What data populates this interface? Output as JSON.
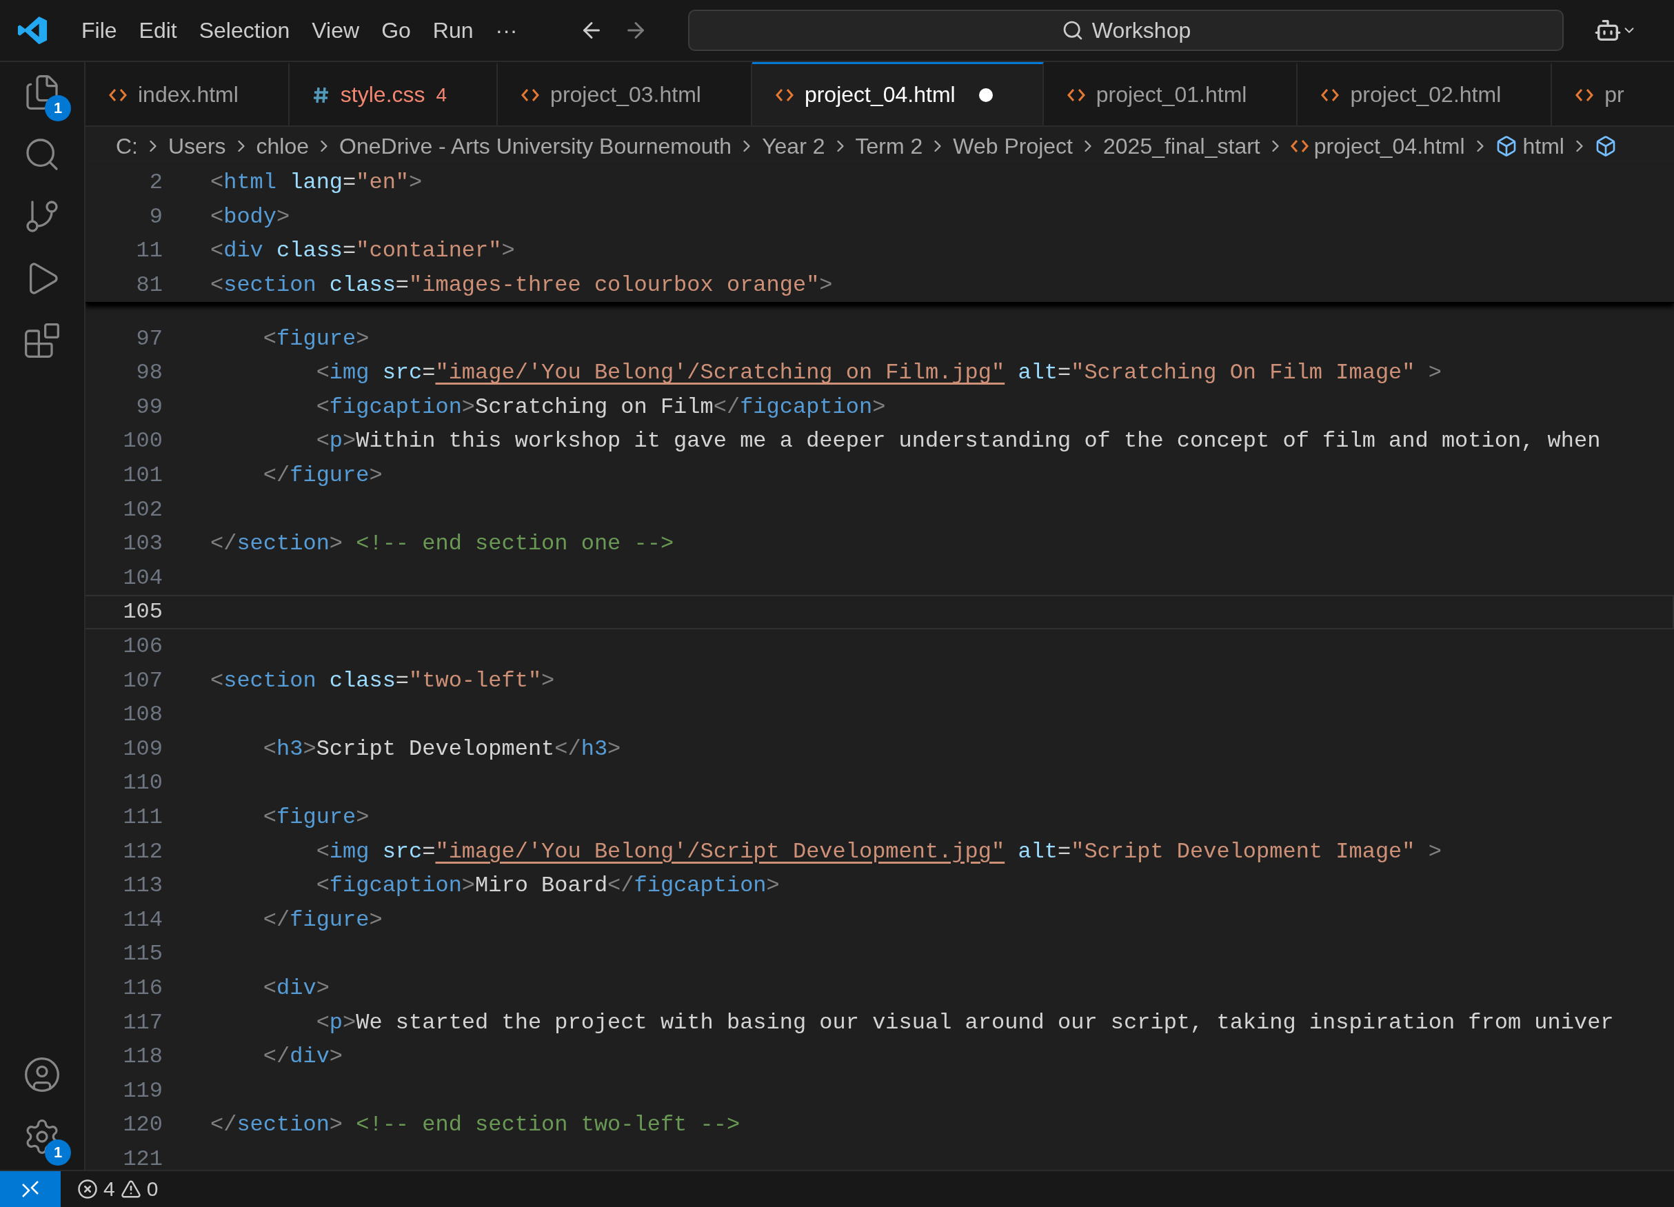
{
  "title_bar": {
    "menu": [
      "File",
      "Edit",
      "Selection",
      "View",
      "Go",
      "Run",
      "···"
    ],
    "search": {
      "value": "Workshop"
    }
  },
  "activity_bar": {
    "top": [
      {
        "kind": "explorer",
        "badge": "1"
      },
      {
        "kind": "search"
      },
      {
        "kind": "source-control"
      },
      {
        "kind": "run"
      },
      {
        "kind": "extensions"
      }
    ],
    "bottom": [
      {
        "kind": "account"
      },
      {
        "kind": "settings",
        "badge": "1"
      }
    ]
  },
  "tabs": [
    {
      "label": "index.html",
      "kind": "html",
      "selected": false,
      "modified": false
    },
    {
      "label": "style.css",
      "kind": "css",
      "selected": false,
      "modified": false,
      "errors": "4"
    },
    {
      "label": "project_03.html",
      "kind": "html",
      "selected": false,
      "modified": false
    },
    {
      "label": "project_04.html",
      "kind": "html",
      "selected": true,
      "modified": true
    },
    {
      "label": "project_01.html",
      "kind": "html",
      "selected": false,
      "modified": false
    },
    {
      "label": "project_02.html",
      "kind": "html",
      "selected": false,
      "modified": false
    },
    {
      "label": "pr",
      "kind": "html",
      "selected": false,
      "modified": false
    }
  ],
  "breadcrumb": [
    {
      "label": "C:",
      "kind": "folder"
    },
    {
      "label": "Users",
      "kind": "folder"
    },
    {
      "label": "chloe",
      "kind": "folder"
    },
    {
      "label": "OneDrive - Arts University Bournemouth",
      "kind": "folder"
    },
    {
      "label": "Year 2",
      "kind": "folder"
    },
    {
      "label": "Term 2",
      "kind": "folder"
    },
    {
      "label": "Web Project",
      "kind": "folder"
    },
    {
      "label": "2025_final_start",
      "kind": "folder"
    },
    {
      "label": "project_04.html",
      "kind": "html"
    },
    {
      "label": "html",
      "kind": "symbol"
    },
    {
      "kind": "symbol"
    }
  ],
  "sticky_lines": [
    {
      "number": "2",
      "code": [
        {
          "kind": "punct",
          "text": "<"
        },
        {
          "kind": "tag",
          "text": "html "
        },
        {
          "kind": "attr",
          "text": "lang"
        },
        {
          "kind": "plain",
          "text": "="
        },
        {
          "kind": "string",
          "text": "\"en\""
        },
        {
          "kind": "punct",
          "text": ">"
        }
      ]
    },
    {
      "number": "9",
      "code": [
        {
          "kind": "punct",
          "text": "<"
        },
        {
          "kind": "tag",
          "text": "body"
        },
        {
          "kind": "punct",
          "text": ">"
        }
      ]
    },
    {
      "number": "11",
      "code": [
        {
          "kind": "punct",
          "text": "<"
        },
        {
          "kind": "tag",
          "text": "div "
        },
        {
          "kind": "attr",
          "text": "class"
        },
        {
          "kind": "plain",
          "text": "="
        },
        {
          "kind": "string",
          "text": "\"container\""
        },
        {
          "kind": "punct",
          "text": ">"
        }
      ]
    },
    {
      "number": "81",
      "code": [
        {
          "kind": "punct",
          "text": "<"
        },
        {
          "kind": "tag",
          "text": "section "
        },
        {
          "kind": "attr",
          "text": "class"
        },
        {
          "kind": "plain",
          "text": "="
        },
        {
          "kind": "string",
          "text": "\"images-three colourbox orange\""
        },
        {
          "kind": "punct",
          "text": ">"
        }
      ]
    }
  ],
  "lines": [
    {
      "number": "97",
      "selected": false,
      "code": [
        {
          "kind": "punct",
          "text": "    <"
        },
        {
          "kind": "tag",
          "text": "figure"
        },
        {
          "kind": "punct",
          "text": ">"
        }
      ]
    },
    {
      "number": "98",
      "selected": false,
      "code": [
        {
          "kind": "punct",
          "text": "        <"
        },
        {
          "kind": "tag",
          "text": "img "
        },
        {
          "kind": "attr",
          "text": "src"
        },
        {
          "kind": "plain",
          "text": "="
        },
        {
          "kind": "link",
          "text": "\"image/'You Belong'/Scratching on Film.jpg\""
        },
        {
          "kind": "attr",
          "text": " alt"
        },
        {
          "kind": "plain",
          "text": "="
        },
        {
          "kind": "string",
          "text": "\"Scratching On Film Image\""
        },
        {
          "kind": "punct",
          "text": " >"
        }
      ]
    },
    {
      "number": "99",
      "selected": false,
      "code": [
        {
          "kind": "punct",
          "text": "        <"
        },
        {
          "kind": "tag",
          "text": "figcaption"
        },
        {
          "kind": "punct",
          "text": ">"
        },
        {
          "kind": "plain",
          "text": "Scratching on Film"
        },
        {
          "kind": "punct",
          "text": "</"
        },
        {
          "kind": "tag",
          "text": "figcaption"
        },
        {
          "kind": "punct",
          "text": ">"
        }
      ]
    },
    {
      "number": "100",
      "selected": false,
      "code": [
        {
          "kind": "punct",
          "text": "        <"
        },
        {
          "kind": "tag",
          "text": "p"
        },
        {
          "kind": "punct",
          "text": ">"
        },
        {
          "kind": "plain",
          "text": "Within this workshop it gave me a deeper understanding of the concept of film and motion, when"
        }
      ]
    },
    {
      "number": "101",
      "selected": false,
      "code": [
        {
          "kind": "punct",
          "text": "    </"
        },
        {
          "kind": "tag",
          "text": "figure"
        },
        {
          "kind": "punct",
          "text": ">"
        }
      ]
    },
    {
      "number": "102",
      "selected": false
    },
    {
      "number": "103",
      "selected": false,
      "code": [
        {
          "kind": "punct",
          "text": "</"
        },
        {
          "kind": "tag",
          "text": "section"
        },
        {
          "kind": "punct",
          "text": ">"
        },
        {
          "kind": "comment",
          "text": " <!-- end section one -->"
        }
      ]
    },
    {
      "number": "104",
      "selected": false
    },
    {
      "number": "105",
      "selected": true
    },
    {
      "number": "106",
      "selected": false
    },
    {
      "number": "107",
      "selected": false,
      "code": [
        {
          "kind": "punct",
          "text": "<"
        },
        {
          "kind": "tag",
          "text": "section "
        },
        {
          "kind": "attr",
          "text": "class"
        },
        {
          "kind": "plain",
          "text": "="
        },
        {
          "kind": "string",
          "text": "\"two-left\""
        },
        {
          "kind": "punct",
          "text": ">"
        }
      ]
    },
    {
      "number": "108",
      "selected": false
    },
    {
      "number": "109",
      "selected": false,
      "code": [
        {
          "kind": "punct",
          "text": "    <"
        },
        {
          "kind": "tag",
          "text": "h3"
        },
        {
          "kind": "punct",
          "text": ">"
        },
        {
          "kind": "plain",
          "text": "Script Development"
        },
        {
          "kind": "punct",
          "text": "</"
        },
        {
          "kind": "tag",
          "text": "h3"
        },
        {
          "kind": "punct",
          "text": ">"
        }
      ]
    },
    {
      "number": "110",
      "selected": false
    },
    {
      "number": "111",
      "selected": false,
      "code": [
        {
          "kind": "punct",
          "text": "    <"
        },
        {
          "kind": "tag",
          "text": "figure"
        },
        {
          "kind": "punct",
          "text": ">"
        }
      ]
    },
    {
      "number": "112",
      "selected": false,
      "code": [
        {
          "kind": "punct",
          "text": "        <"
        },
        {
          "kind": "tag",
          "text": "img "
        },
        {
          "kind": "attr",
          "text": "src"
        },
        {
          "kind": "plain",
          "text": "="
        },
        {
          "kind": "link",
          "text": "\"image/'You Belong'/Script Development.jpg\""
        },
        {
          "kind": "attr",
          "text": " alt"
        },
        {
          "kind": "plain",
          "text": "="
        },
        {
          "kind": "string",
          "text": "\"Script Development Image\""
        },
        {
          "kind": "punct",
          "text": " >"
        }
      ]
    },
    {
      "number": "113",
      "selected": false,
      "code": [
        {
          "kind": "punct",
          "text": "        <"
        },
        {
          "kind": "tag",
          "text": "figcaption"
        },
        {
          "kind": "punct",
          "text": ">"
        },
        {
          "kind": "plain",
          "text": "Miro Board"
        },
        {
          "kind": "punct",
          "text": "</"
        },
        {
          "kind": "tag",
          "text": "figcaption"
        },
        {
          "kind": "punct",
          "text": ">"
        }
      ]
    },
    {
      "number": "114",
      "selected": false,
      "code": [
        {
          "kind": "punct",
          "text": "    </"
        },
        {
          "kind": "tag",
          "text": "figure"
        },
        {
          "kind": "punct",
          "text": ">"
        }
      ]
    },
    {
      "number": "115",
      "selected": false
    },
    {
      "number": "116",
      "selected": false,
      "code": [
        {
          "kind": "punct",
          "text": "    <"
        },
        {
          "kind": "tag",
          "text": "div"
        },
        {
          "kind": "punct",
          "text": ">"
        }
      ]
    },
    {
      "number": "117",
      "selected": false,
      "code": [
        {
          "kind": "punct",
          "text": "        <"
        },
        {
          "kind": "tag",
          "text": "p"
        },
        {
          "kind": "punct",
          "text": ">"
        },
        {
          "kind": "plain",
          "text": "We started the project with basing our visual around our script, taking inspiration from univer"
        }
      ]
    },
    {
      "number": "118",
      "selected": false,
      "code": [
        {
          "kind": "punct",
          "text": "    </"
        },
        {
          "kind": "tag",
          "text": "div"
        },
        {
          "kind": "punct",
          "text": ">"
        }
      ]
    },
    {
      "number": "119",
      "selected": false
    },
    {
      "number": "120",
      "selected": false,
      "code": [
        {
          "kind": "punct",
          "text": "</"
        },
        {
          "kind": "tag",
          "text": "section"
        },
        {
          "kind": "punct",
          "text": ">"
        },
        {
          "kind": "comment",
          "text": " <!-- end section two-left -->"
        }
      ]
    },
    {
      "number": "121",
      "selected": false
    }
  ],
  "status_bar": {
    "errors": "4",
    "warnings": "0"
  }
}
